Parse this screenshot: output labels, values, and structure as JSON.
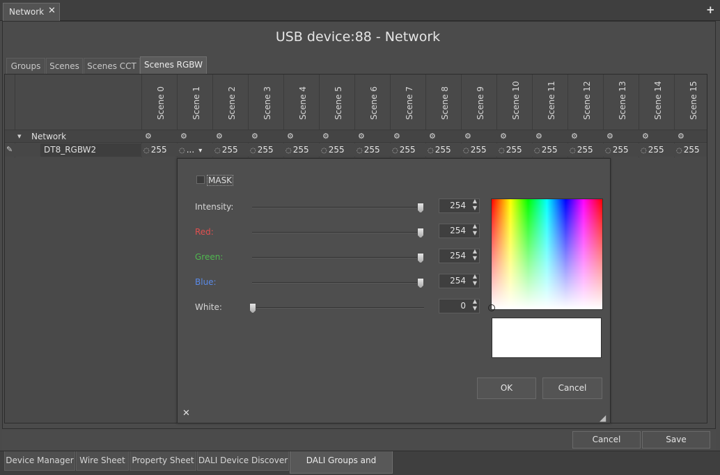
{
  "doc_tab": {
    "label": "Network",
    "close": "✕"
  },
  "plus": "+",
  "title": "USB device:88 - Network",
  "subtabs": [
    "Groups",
    "Scenes",
    "Scenes CCT",
    "Scenes RGBW"
  ],
  "scenes": [
    "Scene 0",
    "Scene 1",
    "Scene 2",
    "Scene 3",
    "Scene 4",
    "Scene 5",
    "Scene 6",
    "Scene 7",
    "Scene 8",
    "Scene 9",
    "Scene 10",
    "Scene 11",
    "Scene 12",
    "Scene 13",
    "Scene 14",
    "Scene 15"
  ],
  "tree": {
    "network_label": "Network",
    "expand_glyph": "▾",
    "device_label": "DT8_RGBW2",
    "edit_glyph": "✎",
    "gear_glyph": "⚙",
    "cell_icon": "◌",
    "cell_value": "255",
    "cell_value_scene1": "...",
    "dropdown_glyph": "▾"
  },
  "popup": {
    "mask_label": "MASK",
    "sliders": [
      {
        "label": "Intensity:",
        "value": "254",
        "level": 1.0,
        "color": "#d6d6d6"
      },
      {
        "label": "Red:",
        "value": "254",
        "level": 1.0,
        "color": "#e05050"
      },
      {
        "label": "Green:",
        "value": "254",
        "level": 1.0,
        "color": "#4fb84f"
      },
      {
        "label": "Blue:",
        "value": "254",
        "level": 1.0,
        "color": "#5a8ae8"
      },
      {
        "label": "White:",
        "value": "0",
        "level": 0.0,
        "color": "#d6d6d6"
      }
    ],
    "spin_up": "▲",
    "spin_down": "▼",
    "ok_label": "OK",
    "cancel_label": "Cancel",
    "close_glyph": "✕",
    "resize_glyph": "◢",
    "preview_color": "#ffffff"
  },
  "bottom_buttons": {
    "cancel": "Cancel",
    "save": "Save"
  },
  "bottom_tabs": [
    "Device Manager",
    "Wire Sheet",
    "Property Sheet",
    "DALI Device Discover",
    "DALI Groups and Scenes"
  ],
  "colors": {
    "background": "#4a4a4a",
    "panel": "#4b4b4b",
    "text": "#d8d8d8"
  }
}
